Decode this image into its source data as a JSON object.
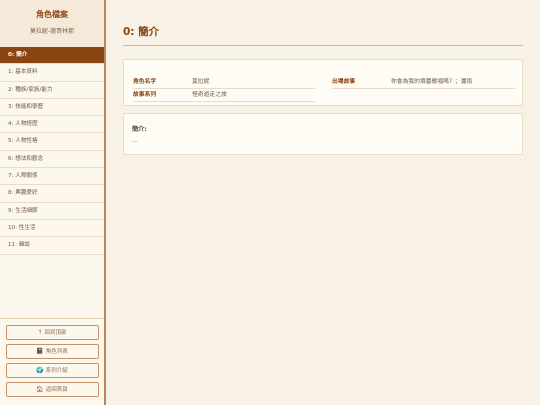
{
  "sidebar": {
    "title": "角色檔案",
    "subtitle": "莫拉妮-德哥林那",
    "nav_items": [
      {
        "label": "0: 簡介"
      },
      {
        "label": "1: 基本資料"
      },
      {
        "label": "2: 種族/家族/能力"
      },
      {
        "label": "3: 技能和學歷"
      },
      {
        "label": "4: 人物經歷"
      },
      {
        "label": "5: 人物性格"
      },
      {
        "label": "6: 想法和觀念"
      },
      {
        "label": "7: 人際關係"
      },
      {
        "label": "8: 興趣愛好"
      },
      {
        "label": "9: 生活細節"
      },
      {
        "label": "10: 性生活"
      },
      {
        "label": "11: 雜談"
      }
    ],
    "buttons": [
      {
        "icon": "↑",
        "label": "回到頂部"
      },
      {
        "icon": "📓",
        "label": "角色列表"
      },
      {
        "icon": "🌍",
        "label": "系列介紹"
      },
      {
        "icon": "🏠",
        "label": "返回首頁"
      }
    ]
  },
  "main": {
    "title": "0: 簡介",
    "info": {
      "name_label": "角色名字",
      "name_value": "莫拉妮",
      "series_label": "故事系列",
      "series_value": "怪奇遊走之旅",
      "story_label": "出場故事",
      "story_value": "你會為我的墳墓歌唱嗎？；瀾雨"
    },
    "intro": {
      "title": "簡介:",
      "body": "..."
    }
  }
}
